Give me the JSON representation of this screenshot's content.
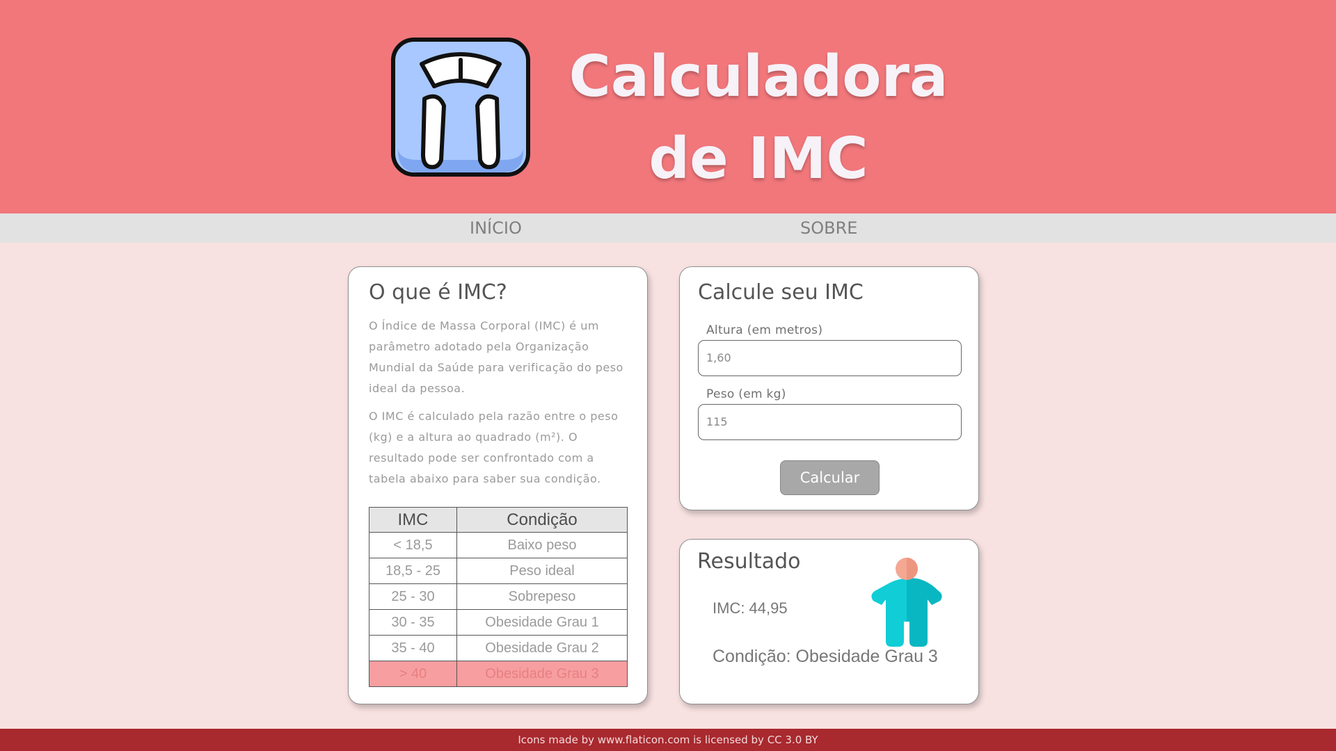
{
  "header": {
    "title_line1": "Calculadora",
    "title_line2": "de IMC",
    "logo_icon": "bathroom-scale-icon"
  },
  "nav": {
    "items": [
      {
        "label": "INÍCIO"
      },
      {
        "label": "SOBRE"
      }
    ]
  },
  "info": {
    "title": "O que é IMC?",
    "paragraph1": "O Índice de Massa Corporal (IMC) é um parâmetro adotado pela Organização Mundial da Saúde para verificação do peso ideal da pessoa.",
    "paragraph2": "O IMC é calculado pela razão entre o peso (kg) e a altura ao quadrado (m²). O resultado pode ser confrontado com a tabela abaixo para saber sua condição.",
    "table": {
      "headers": [
        "IMC",
        "Condição"
      ],
      "rows": [
        {
          "imc": "< 18,5",
          "condition": "Baixo peso"
        },
        {
          "imc": "18,5 - 25",
          "condition": "Peso ideal"
        },
        {
          "imc": "25 - 30",
          "condition": "Sobrepeso"
        },
        {
          "imc": "30 - 35",
          "condition": "Obesidade Grau 1"
        },
        {
          "imc": "35 - 40",
          "condition": "Obesidade Grau 2"
        },
        {
          "imc": "> 40",
          "condition": "Obesidade Grau 3"
        }
      ],
      "highlight_color": "#f79ea0"
    }
  },
  "calculator": {
    "title": "Calcule seu IMC",
    "height_label": "Altura (em metros)",
    "height_value": "1,60",
    "weight_label": "Peso (em kg)",
    "weight_value": "115",
    "button_label": "Calcular"
  },
  "result": {
    "title": "Resultado",
    "imc_text": "IMC: 44,95",
    "condition_text": "Condição: Obesidade Grau 3",
    "icon": "obese-person-icon"
  },
  "footer": {
    "text": "Icons made by www.flaticon.com is licensed by CC 3.0 BY"
  },
  "colors": {
    "header_bg": "#f1777b",
    "page_bg": "#f8e1e1",
    "nav_bg": "#e2e2e2",
    "footer_bg": "#a8292e",
    "button_bg": "#a8a8a8",
    "person_body": "#10cdd6",
    "person_head": "#f4a792"
  }
}
